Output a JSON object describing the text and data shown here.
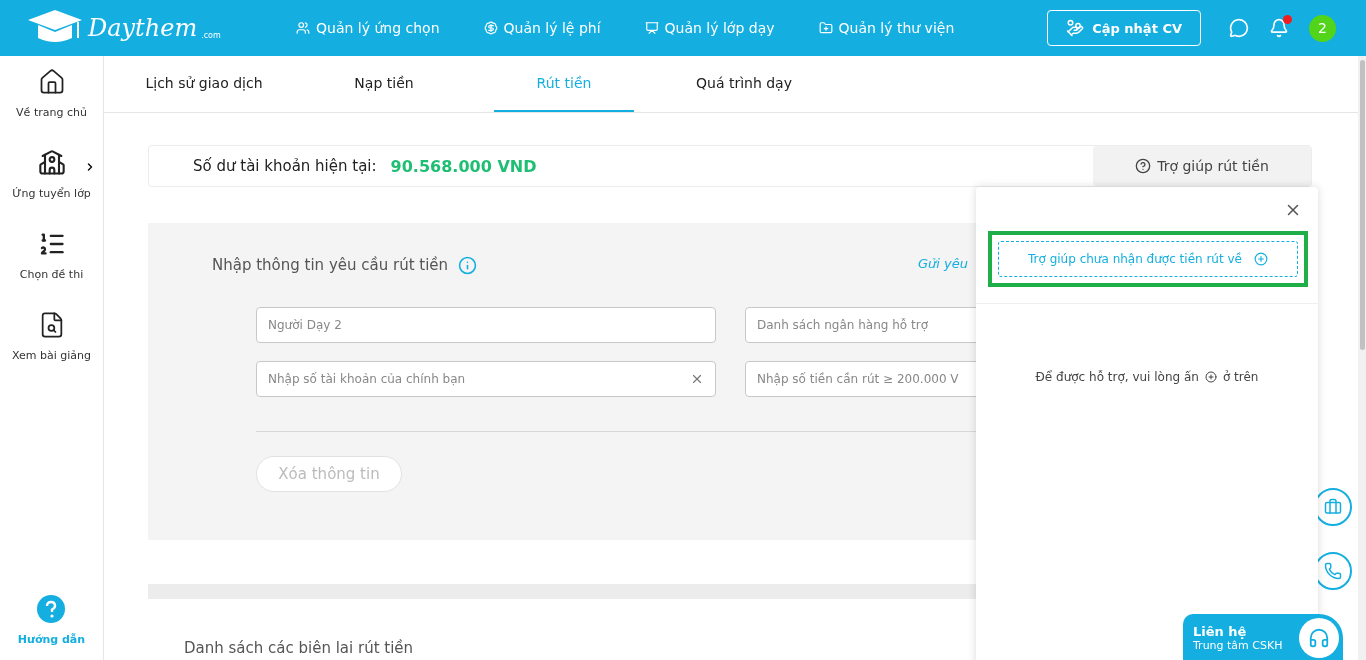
{
  "header": {
    "logo": {
      "name": "Daythem",
      "suffix": ".com"
    },
    "nav": [
      {
        "label": "Quản lý ứng chọn",
        "kind": "people"
      },
      {
        "label": "Quản lý lệ phí",
        "kind": "money"
      },
      {
        "label": "Quản lý lớp dạy",
        "kind": "board"
      },
      {
        "label": "Quản lý thư viện",
        "kind": "folder"
      }
    ],
    "cv_button": "Cập nhật CV",
    "notification_dot": true,
    "avatar": "2"
  },
  "sidebar": {
    "items": [
      {
        "label": "Về trang chủ",
        "kind": "home",
        "has_submenu": false
      },
      {
        "label": "Ứng tuyển lớp",
        "kind": "class",
        "has_submenu": true
      },
      {
        "label": "Chọn đề thi",
        "kind": "list",
        "has_submenu": false
      },
      {
        "label": "Xem bài giảng",
        "kind": "doc",
        "has_submenu": false
      }
    ],
    "help": "Hướng dẫn"
  },
  "tabs": [
    {
      "label": "Lịch sử giao dịch",
      "selected": false
    },
    {
      "label": "Nạp tiền",
      "selected": false
    },
    {
      "label": "Rút tiền",
      "selected": true
    },
    {
      "label": "Quá trình dạy",
      "selected": false
    }
  ],
  "balance": {
    "label": "Số dư tài khoản hiện tại:",
    "value": "90.568.000 VND",
    "help_button": "Trợ giúp rút tiền"
  },
  "form": {
    "title": "Nhập thông tin yêu cầu rút tiền",
    "link": "Gửi yêu",
    "fields": [
      {
        "value": "Người Dạy 2",
        "clearable": false
      },
      {
        "placeholder": "Danh sách ngân hàng hỗ trợ",
        "clearable": false
      },
      {
        "placeholder": "Nhập số tài khoản của chính bạn",
        "clearable": true
      },
      {
        "placeholder": "Nhập số tiền cần rút ≥ 200.000 V",
        "clearable": false
      }
    ],
    "clear_button": "Xóa thông tin"
  },
  "receipts": {
    "title": "Danh sách các biên lai rút tiền"
  },
  "help_popover": {
    "add_button": "Trợ giúp chưa nhận được tiền rút về",
    "highlighted": true,
    "hint_before": "Để được hỗ trợ, vui lòng ấn",
    "hint_after": "ở trên"
  },
  "contact": {
    "title": "Liên hệ",
    "subtitle": "Trung tâm CSKH"
  }
}
